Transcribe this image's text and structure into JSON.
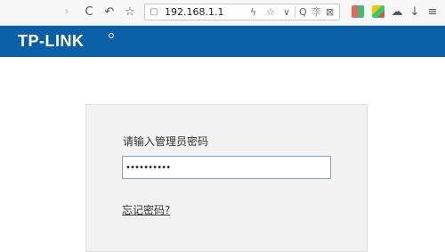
{
  "browser": {
    "address": "192.168.1.1",
    "search_placeholder": "李",
    "nav_icons": {
      "forward": "›",
      "reload": "C",
      "undo": "↶",
      "bookmark": "☆"
    },
    "address_icons": {
      "shield": "▢",
      "bolt": "ϟ",
      "star": "☆",
      "dropdown": "∨",
      "search": "Q",
      "close": "⊠"
    },
    "right_icons": {
      "cloud": "☁",
      "download": "↓",
      "menu": "≡"
    }
  },
  "banner": {
    "logo": "TP-LINK",
    "background": "#0a5fa8"
  },
  "login": {
    "prompt": "请输入管理员密码",
    "password_value": "••••••••••",
    "forgot_link": "忘记密码?"
  }
}
